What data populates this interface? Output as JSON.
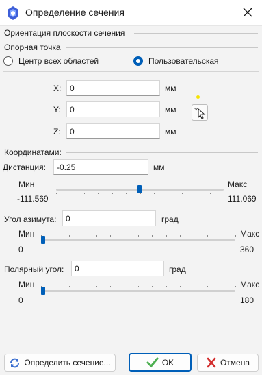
{
  "window": {
    "title": "Определение сечения"
  },
  "orientation": {
    "group_title": "Ориентация плоскости сечения",
    "ref_point_title": "Опорная точка",
    "radio_all": "Центр всех областей",
    "radio_user": "Пользовательская",
    "selected": "user"
  },
  "coords": {
    "x_label": "X:",
    "x_value": "0",
    "x_unit": "мм",
    "y_label": "Y:",
    "y_value": "0",
    "y_unit": "мм",
    "z_label": "Z:",
    "z_value": "0",
    "z_unit": "мм"
  },
  "by_coords": {
    "title": "Координатами:",
    "distance_label": "Дистанция:",
    "distance_value": "-0.25",
    "distance_unit": "мм",
    "min_label": "Мин",
    "max_label": "Макс",
    "min_value": "-111.569",
    "max_value": "111.069",
    "slider_fraction": 0.497
  },
  "azimuth": {
    "label": "Угол азимута:",
    "value": "0",
    "unit": "град",
    "min_label": "Мин",
    "max_label": "Макс",
    "min_value": "0",
    "max_value": "360",
    "slider_fraction": 0
  },
  "polar": {
    "label": "Полярный угол:",
    "value": "0",
    "unit": "град",
    "min_label": "Мин",
    "max_label": "Макс",
    "min_value": "0",
    "max_value": "180",
    "slider_fraction": 0
  },
  "buttons": {
    "define": "Определить сечение...",
    "ok": "OK",
    "cancel": "Отмена"
  },
  "colors": {
    "accent": "#005fb8",
    "ok_check": "#4caf50",
    "cancel_x": "#d32f2f"
  }
}
